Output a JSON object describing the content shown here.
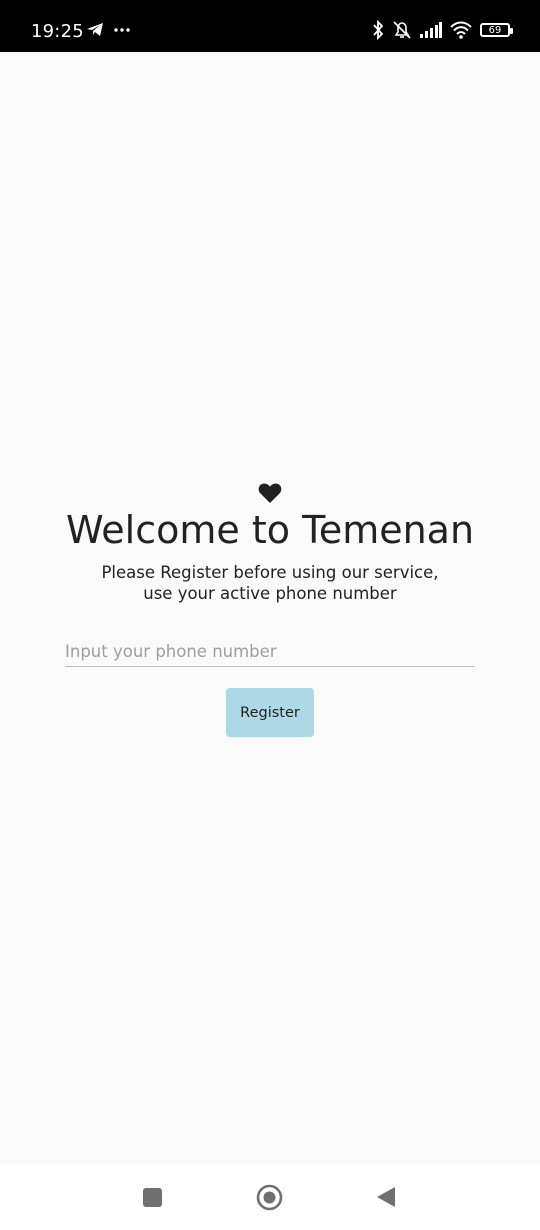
{
  "status_bar": {
    "time": "19:25",
    "left_icons": [
      "telegram-icon",
      "more-dots-icon"
    ],
    "right_icons": [
      "bluetooth-icon",
      "muted-bell-icon",
      "signal-icon",
      "wifi-icon"
    ],
    "battery": "69"
  },
  "main": {
    "icon": "heart-icon",
    "title": "Welcome to Temenan",
    "subtitle_line1": "Please Register before using our service,",
    "subtitle_line2": "use your active phone number",
    "phone_input": {
      "value": "",
      "placeholder": "Input your phone number"
    },
    "register_label": "Register",
    "colors": {
      "button_bg": "#add8e6",
      "text": "#222222",
      "background": "#fafafa"
    }
  },
  "nav_bar": {
    "buttons": [
      "recent-apps-icon",
      "home-icon",
      "back-icon"
    ]
  }
}
